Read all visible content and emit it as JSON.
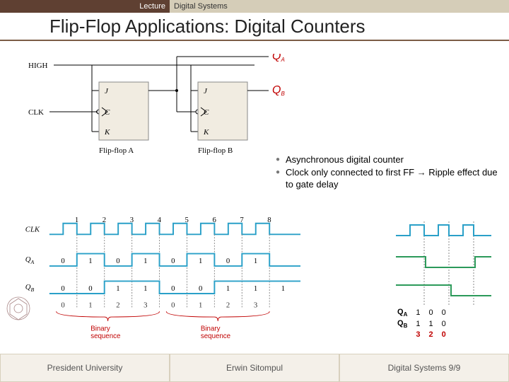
{
  "header": {
    "lecture_label": "Lecture",
    "course": "Digital Systems"
  },
  "title": "Flip-Flop Applications: Digital Counters",
  "circuit": {
    "high": "HIGH",
    "clk": "CLK",
    "j": "J",
    "k": "K",
    "c": "C",
    "ffA": "Flip-flop A",
    "ffB": "Flip-flop B",
    "qa": "Q",
    "qa_sub": "A",
    "qb": "Q",
    "qb_sub": "B"
  },
  "bullets": {
    "b1": "Asynchronous digital counter",
    "b2a": "Clock only connected to first FF ",
    "b2arrow": "→",
    "b2b": " Ripple effect due to gate delay"
  },
  "timing": {
    "clk": "CLK",
    "qa": "Q",
    "qa_sub": "A",
    "qb": "Q",
    "qb_sub": "B",
    "edges": [
      "1",
      "2",
      "3",
      "4",
      "5",
      "6",
      "7",
      "8"
    ],
    "qa_vals": [
      "0",
      "1",
      "0",
      "1",
      "0",
      "1",
      "0",
      "1"
    ],
    "qb_vals": [
      "0",
      "0",
      "1",
      "1",
      "0",
      "0",
      "1",
      "1"
    ],
    "qb_vals_tail": "1",
    "counts": [
      "0",
      "1",
      "2",
      "3",
      "0",
      "1",
      "2",
      "3"
    ],
    "brace_label": "Binary\nsequence",
    "brace_label2": "Binary\nsequence"
  },
  "state": {
    "rowA": "Q",
    "rowA_sub": "A",
    "rowB": "Q",
    "rowB_sub": "B",
    "vals_a": [
      "1",
      "0",
      "0"
    ],
    "vals_b": [
      "1",
      "1",
      "0"
    ],
    "counts": [
      "3",
      "2",
      "0"
    ]
  },
  "footer": {
    "left": "President University",
    "center": "Erwin Sitompul",
    "right": "Digital Systems 9/9"
  }
}
